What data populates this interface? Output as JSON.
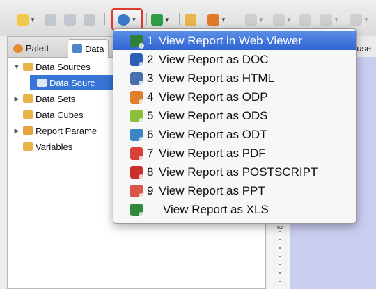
{
  "toolbar": {
    "buttons": [
      {
        "name": "new-file-icon",
        "color": "#f2c94c",
        "has_arrow": true,
        "disabled": false
      },
      {
        "name": "save-icon",
        "color": "#9aa4b5",
        "has_arrow": false,
        "disabled": true
      },
      {
        "name": "save-all-icon",
        "color": "#9aa4b5",
        "has_arrow": false,
        "disabled": true
      },
      {
        "name": "print-icon",
        "color": "#9aa4b5",
        "has_arrow": false,
        "disabled": true
      }
    ],
    "run_button": {
      "name": "run-report-globe-icon",
      "color": "#3a78c9"
    },
    "after_buttons": [
      {
        "name": "debug-icon",
        "color": "#2e9e46",
        "has_arrow": true,
        "disabled": false
      },
      {
        "name": "open-folder-icon",
        "color": "#e9b44c",
        "has_arrow": false,
        "disabled": false
      },
      {
        "name": "edit-pencil-icon",
        "color": "#e07b2a",
        "has_arrow": true,
        "disabled": false
      },
      {
        "name": "nav-back-icon",
        "color": "#b3b3b3",
        "has_arrow": true,
        "disabled": true
      },
      {
        "name": "nav-history-icon",
        "color": "#b3b3b3",
        "has_arrow": true,
        "disabled": true
      },
      {
        "name": "nav-prev-icon",
        "color": "#b3b3b3",
        "has_arrow": false,
        "disabled": true
      },
      {
        "name": "nav-left-icon",
        "color": "#b3b3b3",
        "has_arrow": true,
        "disabled": true
      },
      {
        "name": "nav-right-icon",
        "color": "#b3b3b3",
        "has_arrow": true,
        "disabled": true
      }
    ]
  },
  "tabs": {
    "palette": "Palett",
    "data": "Data",
    "palette_icon_color": "#e58a2e",
    "data_icon_color": "#4b86c8"
  },
  "tree": {
    "items": [
      {
        "label": "Data Sources",
        "twisty": "▼",
        "icon_color": "#e6b447",
        "selected": false
      },
      {
        "label": "Data Sourc",
        "twisty": "",
        "icon_color": "#dfe8f5",
        "selected": true
      },
      {
        "label": "Data Sets",
        "twisty": "▶",
        "icon_color": "#e6b447",
        "selected": false
      },
      {
        "label": "Data Cubes",
        "twisty": "",
        "icon_color": "#e6b447",
        "selected": false
      },
      {
        "label": "Report Parame",
        "twisty": "▶",
        "icon_color": "#e6a23c",
        "selected": false
      },
      {
        "label": "Variables",
        "twisty": "",
        "icon_color": "#e6b447",
        "selected": false
      }
    ]
  },
  "editor": {
    "tab_label": "_use",
    "ruler_number": "2"
  },
  "menu": {
    "items": [
      {
        "number": "1",
        "label": "View Report in Web Viewer",
        "icon": "web-viewer-icon",
        "icon_color": "#2f7f3c",
        "highlight": true
      },
      {
        "number": "2",
        "label": "View Report as DOC",
        "icon": "doc-icon",
        "icon_color": "#2b5fb4",
        "highlight": false
      },
      {
        "number": "3",
        "label": "View Report as HTML",
        "icon": "html-icon",
        "icon_color": "#4a6fb0",
        "highlight": false
      },
      {
        "number": "4",
        "label": "View Report as ODP",
        "icon": "odp-icon",
        "icon_color": "#e07e2c",
        "highlight": false
      },
      {
        "number": "5",
        "label": "View Report as ODS",
        "icon": "ods-icon",
        "icon_color": "#8bbf3a",
        "highlight": false
      },
      {
        "number": "6",
        "label": "View Report as ODT",
        "icon": "odt-icon",
        "icon_color": "#3d86c6",
        "highlight": false
      },
      {
        "number": "7",
        "label": "View Report as PDF",
        "icon": "pdf-icon",
        "icon_color": "#d8413a",
        "highlight": false
      },
      {
        "number": "8",
        "label": "View Report as POSTSCRIPT",
        "icon": "postscript-icon",
        "icon_color": "#c9302c",
        "highlight": false
      },
      {
        "number": "9",
        "label": "View Report as PPT",
        "icon": "ppt-icon",
        "icon_color": "#d9544a",
        "highlight": false
      },
      {
        "number": "",
        "label": "View Report as XLS",
        "icon": "xls-icon",
        "icon_color": "#2f8a3c",
        "highlight": false
      }
    ]
  }
}
